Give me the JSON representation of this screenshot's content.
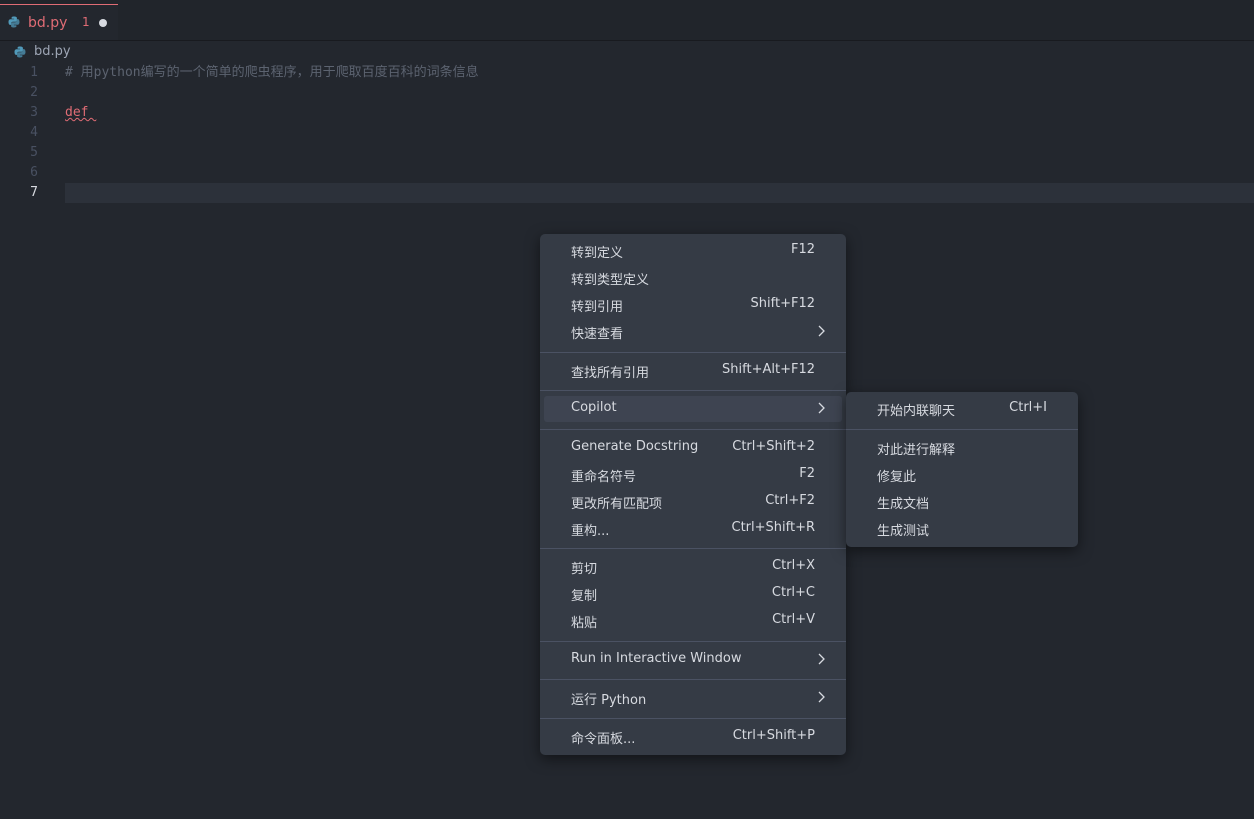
{
  "tab": {
    "filename": "bd.py",
    "problem_count": "1"
  },
  "breadcrumb": {
    "file": "bd.py"
  },
  "editor": {
    "lines": [
      {
        "num": "1",
        "text": "# 用python编写的一个简单的爬虫程序，用于爬取百度百科的词条信息"
      },
      {
        "num": "2",
        "text": ""
      },
      {
        "num": "3",
        "text": "def "
      },
      {
        "num": "4",
        "text": ""
      },
      {
        "num": "5",
        "text": ""
      },
      {
        "num": "6",
        "text": ""
      },
      {
        "num": "7",
        "text": ""
      }
    ]
  },
  "context_menu": {
    "items": [
      {
        "label": "转到定义",
        "key": "F12"
      },
      {
        "label": "转到类型定义",
        "key": ""
      },
      {
        "label": "转到引用",
        "key": "Shift+F12"
      },
      {
        "label": "快速查看",
        "key": ""
      },
      {
        "label": "查找所有引用",
        "key": "Shift+Alt+F12"
      },
      {
        "label": "Copilot",
        "key": ""
      },
      {
        "label": "Generate Docstring",
        "key": "Ctrl+Shift+2"
      },
      {
        "label": "重命名符号",
        "key": "F2"
      },
      {
        "label": "更改所有匹配项",
        "key": "Ctrl+F2"
      },
      {
        "label": "重构...",
        "key": "Ctrl+Shift+R"
      },
      {
        "label": "剪切",
        "key": "Ctrl+X"
      },
      {
        "label": "复制",
        "key": "Ctrl+C"
      },
      {
        "label": "粘贴",
        "key": "Ctrl+V"
      },
      {
        "label": "Run in Interactive Window",
        "key": ""
      },
      {
        "label": "运行 Python",
        "key": ""
      },
      {
        "label": "命令面板...",
        "key": "Ctrl+Shift+P"
      }
    ]
  },
  "copilot_submenu": {
    "items": [
      {
        "label": "开始内联聊天",
        "key": "Ctrl+I"
      },
      {
        "label": "对此进行解释",
        "key": ""
      },
      {
        "label": "修复此",
        "key": ""
      },
      {
        "label": "生成文档",
        "key": ""
      },
      {
        "label": "生成测试",
        "key": ""
      }
    ]
  },
  "colors": {
    "accent": "#e06c75",
    "menu_bg": "#353b45",
    "editor_bg": "#23272e"
  }
}
